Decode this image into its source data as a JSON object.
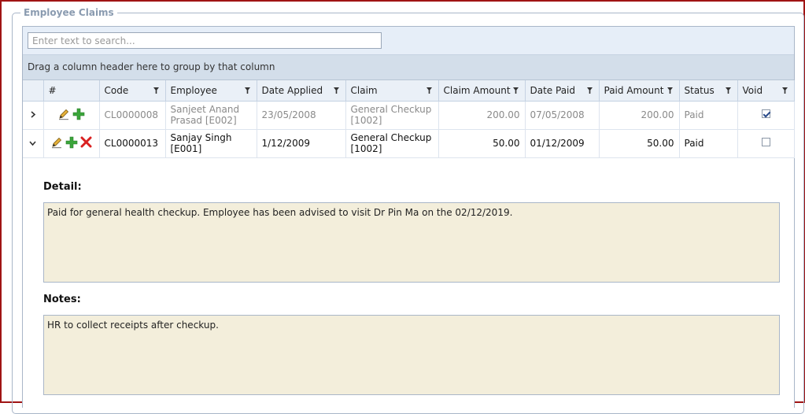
{
  "panel": {
    "title": "Employee Claims"
  },
  "search": {
    "placeholder": "Enter text to search..."
  },
  "group_hint": "Drag a column header here to group by that column",
  "columns": {
    "hash": "#",
    "code": "Code",
    "employee": "Employee",
    "date_applied": "Date Applied",
    "claim": "Claim",
    "claim_amount": "Claim Amount",
    "date_paid": "Date Paid",
    "paid_amount": "Paid Amount",
    "status": "Status",
    "void": "Void"
  },
  "rows": [
    {
      "expanded": false,
      "code": "CL0000008",
      "employee_line1": "Sanjeet Anand",
      "employee_line2": "Prasad [E002]",
      "date_applied": "23/05/2008",
      "claim_line1": "General Checkup",
      "claim_line2": "[1002]",
      "claim_amount": "200.00",
      "date_paid": "07/05/2008",
      "paid_amount": "200.00",
      "status": "Paid",
      "void": true
    },
    {
      "expanded": true,
      "code": "CL0000013",
      "employee_line1": "Sanjay Singh",
      "employee_line2": "[E001]",
      "date_applied": "1/12/2009",
      "claim_line1": "General Checkup",
      "claim_line2": "[1002]",
      "claim_amount": "50.00",
      "date_paid": "01/12/2009",
      "paid_amount": "50.00",
      "status": "Paid",
      "void": false
    }
  ],
  "detail": {
    "detail_label": "Detail:",
    "detail_text": "Paid for general health checkup. Employee has been advised to visit Dr Pin Ma on the 02/12/2019.",
    "notes_label": "Notes:",
    "notes_text": "HR to collect receipts after checkup."
  },
  "icons": {
    "expand": "chevron-right-icon",
    "collapse": "chevron-down-icon",
    "edit": "pencil-icon",
    "add": "plus-icon",
    "delete": "delete-x-icon",
    "filter": "filter-funnel-icon"
  },
  "colors": {
    "frame_border": "#a01414",
    "header_bg": "#eaf0f7",
    "group_bg": "#d3deea",
    "note_bg": "#f3eedb",
    "add_green": "#3aa53a",
    "delete_red": "#d92020"
  }
}
